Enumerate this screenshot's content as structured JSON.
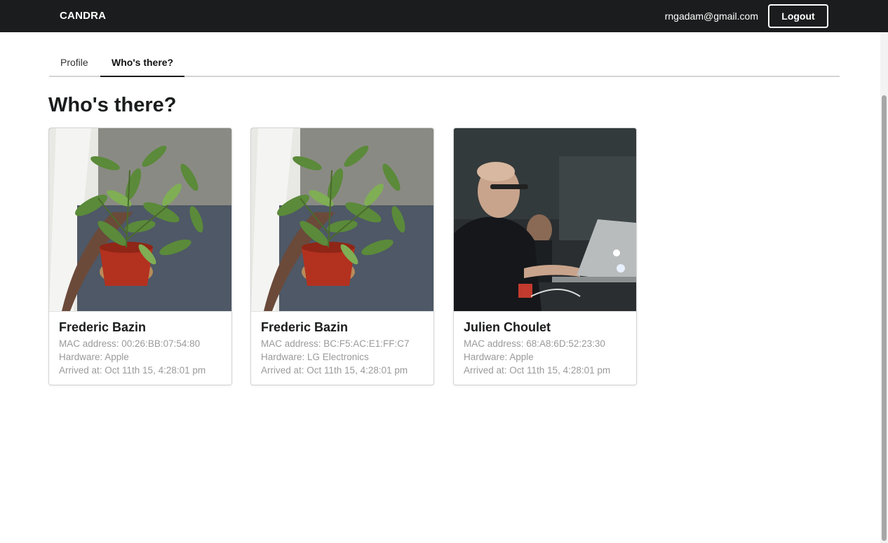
{
  "header": {
    "brand": "CANDRA",
    "user_email": "rngadam@gmail.com",
    "logout_label": "Logout"
  },
  "tabs": [
    {
      "label": "Profile",
      "active": false
    },
    {
      "label": "Who's there?",
      "active": true
    }
  ],
  "main": {
    "title": "Who's there?"
  },
  "devices": [
    {
      "name": "Frederic Bazin",
      "mac": "MAC address: 00:26:BB:07:54:80",
      "hardware": "Hardware: Apple",
      "arrived": "Arrived at: Oct 11th 15, 4:28:01 pm",
      "photo": "potted-plant"
    },
    {
      "name": "Frederic Bazin",
      "mac": "MAC address: BC:F5:AC:E1:FF:C7",
      "hardware": "Hardware: LG Electronics",
      "arrived": "Arrived at: Oct 11th 15, 4:28:01 pm",
      "photo": "potted-plant"
    },
    {
      "name": "Julien Choulet",
      "mac": "MAC address: 68:A8:6D:52:23:30",
      "hardware": "Hardware: Apple",
      "arrived": "Arrived at: Oct 11th 15, 4:28:01 pm",
      "photo": "person-at-laptop"
    }
  ],
  "colors": {
    "topbar": "#1b1c1d",
    "meta_text": "#9a9a9a",
    "divider": "#d4d4d5"
  }
}
